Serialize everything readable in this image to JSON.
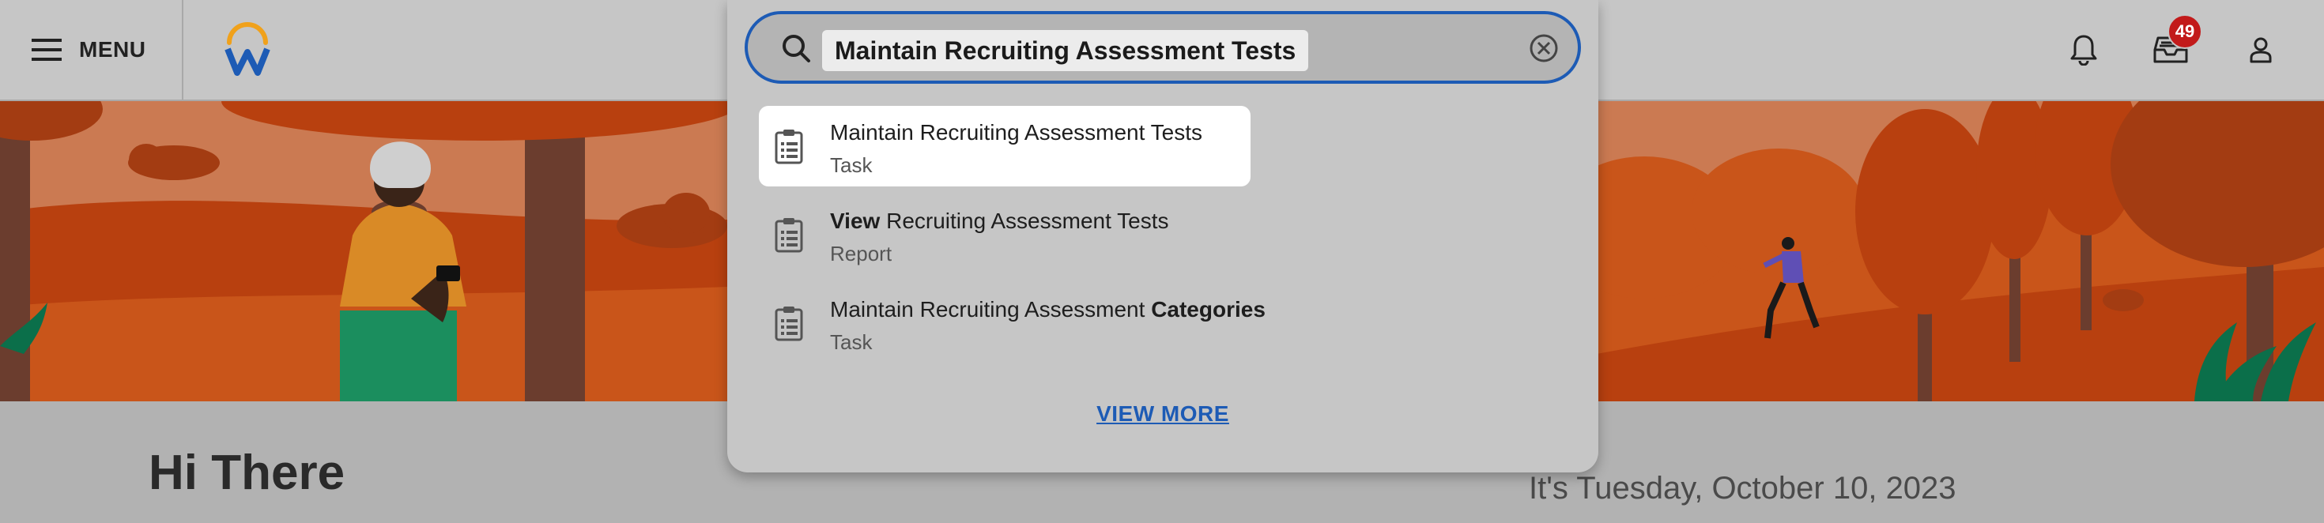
{
  "header": {
    "menu_label": "MENU",
    "inbox_badge": "49",
    "icons": [
      "menu-icon",
      "workday-logo",
      "bell-icon",
      "inbox-icon",
      "user-icon"
    ]
  },
  "search": {
    "query": "Maintain Recruiting Assessment Tests",
    "results": [
      {
        "pre": "",
        "bold": "",
        "post": "Maintain Recruiting Assessment Tests",
        "type": "Task",
        "active": true
      },
      {
        "pre": "",
        "bold": "View",
        "post": " Recruiting Assessment Tests",
        "type": "Report",
        "active": false
      },
      {
        "pre": "Maintain Recruiting Assessment ",
        "bold": "Categories",
        "post": "",
        "type": "Task",
        "active": false
      }
    ],
    "view_more": "VIEW MORE"
  },
  "main": {
    "greeting": "Hi There",
    "date": "It's Tuesday, October 10, 2023"
  },
  "colors": {
    "accent": "#1d5bb5",
    "badge": "#c21a1a",
    "banner_sky": "#cb7a52",
    "banner_ground": "#b8400f"
  }
}
